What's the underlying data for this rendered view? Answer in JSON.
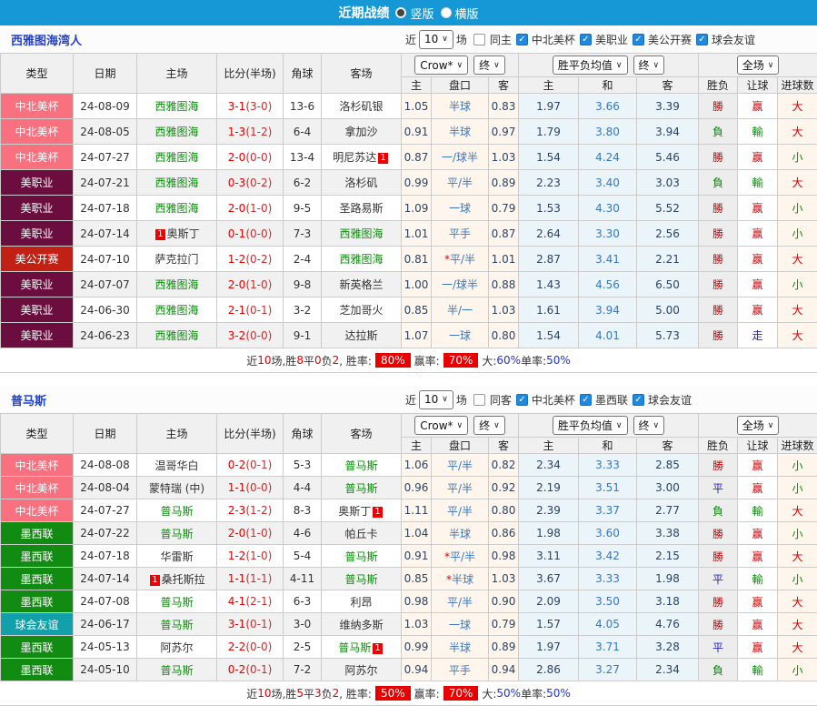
{
  "title_bar": {
    "title": "近期战绩",
    "vertical": "竖版",
    "horizontal": "横版"
  },
  "header": {
    "main": [
      "类型",
      "日期",
      "主场",
      "比分(半场)",
      "角球",
      "客场"
    ],
    "crow_select": "Crow*",
    "final_select": "终",
    "avg_select": "胜平负均值",
    "final_select2": "终",
    "full_select": "全场",
    "sub": [
      "主",
      "盘口",
      "客",
      "主",
      "和",
      "客",
      "胜负",
      "让球",
      "进球数"
    ]
  },
  "league_colors": {
    "中北美杯": "#F9707E",
    "美职业": "#6B0D3E",
    "美公开赛": "#C02114",
    "墨西联": "#118B11",
    "球会友谊": "#12A1AB"
  },
  "status_colors": {
    "win": "#D40000",
    "lose": "#0B8A0B",
    "draw": "#2222CC",
    "focus_team": "#089008",
    "score": "#E50000",
    "titlebar": "#1697D6",
    "checkbox": "#1E88E5"
  },
  "sections": [
    {
      "team": "西雅图海湾人",
      "controls": {
        "near": "近",
        "count": "10",
        "games": "场",
        "same": "同主",
        "leagues": [
          "中北美杯",
          "美职业",
          "美公开赛",
          "球会友谊"
        ]
      },
      "rows": [
        {
          "league": "中北美杯",
          "date": "24-08-09",
          "home": {
            "name": "西雅图海",
            "green": true
          },
          "score": "3-1",
          "half": "(3-0)",
          "corners": "13-6",
          "away": {
            "name": "洛杉矶银",
            "green": false
          },
          "crow": [
            "1.05",
            "半球",
            "0.83"
          ],
          "avg": [
            "1.97",
            "3.66",
            "3.39"
          ],
          "results": [
            [
              "勝",
              "w"
            ],
            [
              "赢",
              "w"
            ],
            [
              "大",
              "w"
            ]
          ]
        },
        {
          "league": "中北美杯",
          "date": "24-08-05",
          "home": {
            "name": "西雅图海",
            "green": true
          },
          "score": "1-3",
          "half": "(1-2)",
          "corners": "6-4",
          "away": {
            "name": "拿加沙",
            "green": false
          },
          "crow": [
            "0.91",
            "半球",
            "0.97"
          ],
          "avg": [
            "1.79",
            "3.80",
            "3.94"
          ],
          "results": [
            [
              "負",
              "l"
            ],
            [
              "輸",
              "l"
            ],
            [
              "大",
              "w"
            ]
          ]
        },
        {
          "league": "中北美杯",
          "date": "24-07-27",
          "home": {
            "name": "西雅图海",
            "green": true
          },
          "score": "2-0",
          "half": "(0-0)",
          "corners": "13-4",
          "away": {
            "name": "明尼苏达",
            "green": false,
            "badge": "after"
          },
          "crow": [
            "0.87",
            "一/球半",
            "1.03"
          ],
          "avg": [
            "1.54",
            "4.24",
            "5.46"
          ],
          "results": [
            [
              "勝",
              "w"
            ],
            [
              "赢",
              "w"
            ],
            [
              "小",
              "l"
            ]
          ]
        },
        {
          "league": "美职业",
          "date": "24-07-21",
          "home": {
            "name": "西雅图海",
            "green": true
          },
          "score": "0-3",
          "half": "(0-2)",
          "corners": "6-2",
          "away": {
            "name": "洛杉矶",
            "green": false
          },
          "crow": [
            "0.99",
            "平/半",
            "0.89"
          ],
          "avg": [
            "2.23",
            "3.40",
            "3.03"
          ],
          "results": [
            [
              "負",
              "l"
            ],
            [
              "輸",
              "l"
            ],
            [
              "大",
              "w"
            ]
          ]
        },
        {
          "league": "美职业",
          "date": "24-07-18",
          "home": {
            "name": "西雅图海",
            "green": true
          },
          "score": "2-0",
          "half": "(1-0)",
          "corners": "9-5",
          "away": {
            "name": "圣路易斯",
            "green": false
          },
          "crow": [
            "1.09",
            "一球",
            "0.79"
          ],
          "avg": [
            "1.53",
            "4.30",
            "5.52"
          ],
          "results": [
            [
              "勝",
              "w"
            ],
            [
              "赢",
              "w"
            ],
            [
              "小",
              "l"
            ]
          ]
        },
        {
          "league": "美职业",
          "date": "24-07-14",
          "home": {
            "name": "奥斯丁",
            "green": false,
            "badge": "before"
          },
          "score": "0-1",
          "half": "(0-0)",
          "corners": "7-3",
          "away": {
            "name": "西雅图海",
            "green": true
          },
          "crow": [
            "1.01",
            "平手",
            "0.87"
          ],
          "avg": [
            "2.64",
            "3.30",
            "2.56"
          ],
          "results": [
            [
              "勝",
              "w"
            ],
            [
              "赢",
              "w"
            ],
            [
              "小",
              "l"
            ]
          ]
        },
        {
          "league": "美公开赛",
          "date": "24-07-10",
          "home": {
            "name": "萨克拉门",
            "green": false
          },
          "score": "1-2",
          "half": "(0-2)",
          "corners": "2-4",
          "away": {
            "name": "西雅图海",
            "green": true
          },
          "crow": [
            "0.81",
            "*平/半",
            "1.01"
          ],
          "avg": [
            "2.87",
            "3.41",
            "2.21"
          ],
          "results": [
            [
              "勝",
              "w"
            ],
            [
              "赢",
              "w"
            ],
            [
              "大",
              "w"
            ]
          ]
        },
        {
          "league": "美职业",
          "date": "24-07-07",
          "home": {
            "name": "西雅图海",
            "green": true
          },
          "score": "2-0",
          "half": "(1-0)",
          "corners": "9-8",
          "away": {
            "name": "新英格兰",
            "green": false
          },
          "crow": [
            "1.00",
            "一/球半",
            "0.88"
          ],
          "avg": [
            "1.43",
            "4.56",
            "6.50"
          ],
          "results": [
            [
              "勝",
              "w"
            ],
            [
              "赢",
              "w"
            ],
            [
              "小",
              "l"
            ]
          ]
        },
        {
          "league": "美职业",
          "date": "24-06-30",
          "home": {
            "name": "西雅图海",
            "green": true
          },
          "score": "2-1",
          "half": "(0-1)",
          "corners": "3-2",
          "away": {
            "name": "芝加哥火",
            "green": false
          },
          "crow": [
            "0.85",
            "半/一",
            "1.03"
          ],
          "avg": [
            "1.61",
            "3.94",
            "5.00"
          ],
          "results": [
            [
              "勝",
              "w"
            ],
            [
              "赢",
              "w"
            ],
            [
              "大",
              "w"
            ]
          ]
        },
        {
          "league": "美职业",
          "date": "24-06-23",
          "home": {
            "name": "西雅图海",
            "green": true
          },
          "score": "3-2",
          "half": "(0-0)",
          "corners": "9-1",
          "away": {
            "name": "达拉斯",
            "green": false
          },
          "crow": [
            "1.07",
            "一球",
            "0.80"
          ],
          "avg": [
            "1.54",
            "4.01",
            "5.73"
          ],
          "results": [
            [
              "勝",
              "w"
            ],
            [
              "走",
              "d"
            ],
            [
              "大",
              "w"
            ]
          ]
        }
      ],
      "footer": [
        [
          "近",
          "p"
        ],
        [
          "10",
          "n"
        ],
        [
          "场,胜",
          "p"
        ],
        [
          "8",
          "n"
        ],
        [
          "平",
          "p"
        ],
        [
          "0",
          "n"
        ],
        [
          "负",
          "p"
        ],
        [
          "2",
          "n"
        ],
        [
          ", 胜率:",
          "p"
        ],
        [
          "80%",
          "b"
        ],
        [
          "赢率:",
          "p"
        ],
        [
          "70%",
          "b"
        ],
        [
          "大:",
          "p"
        ],
        [
          "60%",
          "u"
        ],
        [
          " 单率:",
          "p"
        ],
        [
          "50%",
          "u"
        ]
      ]
    },
    {
      "team": "普马斯",
      "controls": {
        "near": "近",
        "count": "10",
        "games": "场",
        "same": "同客",
        "leagues": [
          "中北美杯",
          "墨西联",
          "球会友谊"
        ]
      },
      "rows": [
        {
          "league": "中北美杯",
          "date": "24-08-08",
          "home": {
            "name": "温哥华白",
            "green": false
          },
          "score": "0-2",
          "half": "(0-1)",
          "corners": "5-3",
          "away": {
            "name": "普马斯",
            "green": true
          },
          "crow": [
            "1.06",
            "平/半",
            "0.82"
          ],
          "avg": [
            "2.34",
            "3.33",
            "2.85"
          ],
          "results": [
            [
              "勝",
              "w"
            ],
            [
              "赢",
              "w"
            ],
            [
              "小",
              "l"
            ]
          ]
        },
        {
          "league": "中北美杯",
          "date": "24-08-04",
          "home": {
            "name": "蒙特瑞 (中)",
            "green": false
          },
          "score": "1-1",
          "half": "(0-0)",
          "corners": "4-4",
          "away": {
            "name": "普马斯",
            "green": true
          },
          "crow": [
            "0.96",
            "平/半",
            "0.92"
          ],
          "avg": [
            "2.19",
            "3.51",
            "3.00"
          ],
          "results": [
            [
              "平",
              "d"
            ],
            [
              "赢",
              "w"
            ],
            [
              "小",
              "l"
            ]
          ]
        },
        {
          "league": "中北美杯",
          "date": "24-07-27",
          "home": {
            "name": "普马斯",
            "green": true
          },
          "score": "2-3",
          "half": "(1-2)",
          "corners": "8-3",
          "away": {
            "name": "奥斯丁",
            "green": false,
            "badge": "after"
          },
          "crow": [
            "1.11",
            "平/半",
            "0.80"
          ],
          "avg": [
            "2.39",
            "3.37",
            "2.77"
          ],
          "results": [
            [
              "負",
              "l"
            ],
            [
              "輸",
              "l"
            ],
            [
              "大",
              "w"
            ]
          ]
        },
        {
          "league": "墨西联",
          "date": "24-07-22",
          "home": {
            "name": "普马斯",
            "green": true
          },
          "score": "2-0",
          "half": "(1-0)",
          "corners": "4-6",
          "away": {
            "name": "帕丘卡",
            "green": false
          },
          "crow": [
            "1.04",
            "半球",
            "0.86"
          ],
          "avg": [
            "1.98",
            "3.60",
            "3.38"
          ],
          "results": [
            [
              "勝",
              "w"
            ],
            [
              "赢",
              "w"
            ],
            [
              "小",
              "l"
            ]
          ]
        },
        {
          "league": "墨西联",
          "date": "24-07-18",
          "home": {
            "name": "华雷斯",
            "green": false
          },
          "score": "1-2",
          "half": "(1-0)",
          "corners": "5-4",
          "away": {
            "name": "普马斯",
            "green": true
          },
          "crow": [
            "0.91",
            "*平/半",
            "0.98"
          ],
          "avg": [
            "3.11",
            "3.42",
            "2.15"
          ],
          "results": [
            [
              "勝",
              "w"
            ],
            [
              "赢",
              "w"
            ],
            [
              "大",
              "w"
            ]
          ]
        },
        {
          "league": "墨西联",
          "date": "24-07-14",
          "home": {
            "name": "桑托斯拉",
            "green": false,
            "badge": "before"
          },
          "score": "1-1",
          "half": "(1-1)",
          "corners": "4-11",
          "away": {
            "name": "普马斯",
            "green": true
          },
          "crow": [
            "0.85",
            "*半球",
            "1.03"
          ],
          "avg": [
            "3.67",
            "3.33",
            "1.98"
          ],
          "results": [
            [
              "平",
              "d"
            ],
            [
              "輸",
              "l"
            ],
            [
              "小",
              "l"
            ]
          ]
        },
        {
          "league": "墨西联",
          "date": "24-07-08",
          "home": {
            "name": "普马斯",
            "green": true
          },
          "score": "4-1",
          "half": "(2-1)",
          "corners": "6-3",
          "away": {
            "name": "利昂",
            "green": false
          },
          "crow": [
            "0.98",
            "平/半",
            "0.90"
          ],
          "avg": [
            "2.09",
            "3.50",
            "3.18"
          ],
          "results": [
            [
              "勝",
              "w"
            ],
            [
              "赢",
              "w"
            ],
            [
              "大",
              "w"
            ]
          ]
        },
        {
          "league": "球会友谊",
          "date": "24-06-17",
          "home": {
            "name": "普马斯",
            "green": true
          },
          "score": "3-1",
          "half": "(0-1)",
          "corners": "3-0",
          "away": {
            "name": "维纳多斯",
            "green": false
          },
          "crow": [
            "1.03",
            "一球",
            "0.79"
          ],
          "avg": [
            "1.57",
            "4.05",
            "4.76"
          ],
          "results": [
            [
              "勝",
              "w"
            ],
            [
              "赢",
              "w"
            ],
            [
              "大",
              "w"
            ]
          ]
        },
        {
          "league": "墨西联",
          "date": "24-05-13",
          "home": {
            "name": "阿苏尔",
            "green": false
          },
          "score": "2-2",
          "half": "(0-0)",
          "corners": "2-5",
          "away": {
            "name": "普马斯",
            "green": true,
            "badge": "after"
          },
          "crow": [
            "0.99",
            "半球",
            "0.89"
          ],
          "avg": [
            "1.97",
            "3.71",
            "3.28"
          ],
          "results": [
            [
              "平",
              "d"
            ],
            [
              "赢",
              "w"
            ],
            [
              "大",
              "w"
            ]
          ]
        },
        {
          "league": "墨西联",
          "date": "24-05-10",
          "home": {
            "name": "普马斯",
            "green": true
          },
          "score": "0-2",
          "half": "(0-1)",
          "corners": "7-2",
          "away": {
            "name": "阿苏尔",
            "green": false
          },
          "crow": [
            "0.94",
            "平手",
            "0.94"
          ],
          "avg": [
            "2.86",
            "3.27",
            "2.34"
          ],
          "results": [
            [
              "負",
              "l"
            ],
            [
              "輸",
              "l"
            ],
            [
              "小",
              "l"
            ]
          ]
        }
      ],
      "footer": [
        [
          "近",
          "p"
        ],
        [
          "10",
          "n"
        ],
        [
          "场,胜",
          "p"
        ],
        [
          "5",
          "n"
        ],
        [
          "平",
          "p"
        ],
        [
          "3",
          "n"
        ],
        [
          "负",
          "p"
        ],
        [
          "2",
          "n"
        ],
        [
          ", 胜率:",
          "p"
        ],
        [
          "50%",
          "b"
        ],
        [
          "赢率:",
          "p"
        ],
        [
          "70%",
          "b"
        ],
        [
          "大:",
          "p"
        ],
        [
          "50%",
          "u"
        ],
        [
          " 单率:",
          "p"
        ],
        [
          "50%",
          "u"
        ]
      ]
    }
  ]
}
